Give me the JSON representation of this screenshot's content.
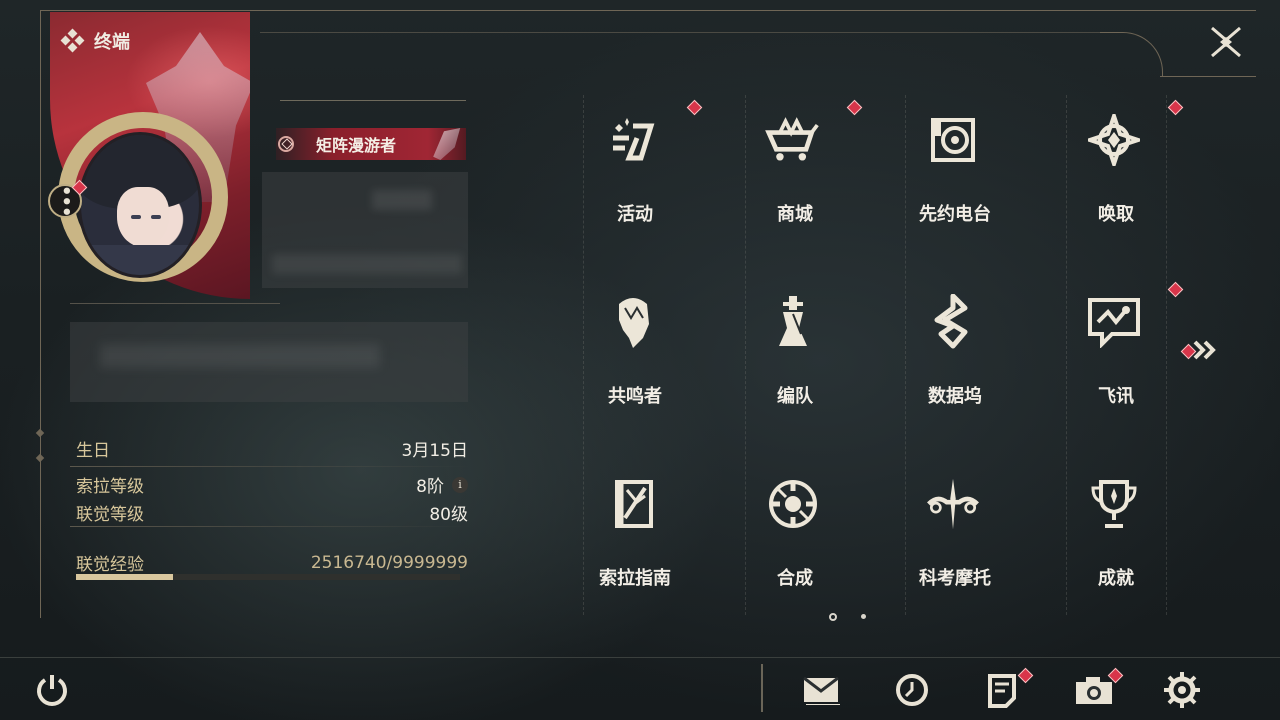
{
  "header": {
    "title": "终端"
  },
  "profile": {
    "title_badge": "矩阵漫游者"
  },
  "info": {
    "birthday_label": "生日",
    "birthday_value": "3月15日",
    "sola_level_label": "索拉等级",
    "sola_level_value": "8阶",
    "union_level_label": "联觉等级",
    "union_level_value": "80级",
    "union_exp_label": "联觉经验",
    "union_exp_value": "2516740/9999999",
    "union_exp_progress": 0.2517
  },
  "menu": {
    "items": [
      {
        "label": "活动",
        "icon": "activity-icon",
        "badge": true
      },
      {
        "label": "商城",
        "icon": "shop-basket-icon",
        "badge": true
      },
      {
        "label": "先约电台",
        "icon": "radio-icon",
        "badge": false
      },
      {
        "label": "唤取",
        "icon": "convene-icon",
        "badge": true
      },
      {
        "label": "共鸣者",
        "icon": "resonator-icon",
        "badge": false
      },
      {
        "label": "编队",
        "icon": "team-chess-icon",
        "badge": false
      },
      {
        "label": "数据坞",
        "icon": "data-dock-icon",
        "badge": false
      },
      {
        "label": "飞讯",
        "icon": "message-chat-icon",
        "badge": true
      },
      {
        "label": "索拉指南",
        "icon": "guide-book-icon",
        "badge": false
      },
      {
        "label": "合成",
        "icon": "synthesis-icon",
        "badge": false
      },
      {
        "label": "科考摩托",
        "icon": "motorcycle-icon",
        "badge": false
      },
      {
        "label": "成就",
        "icon": "trophy-icon",
        "badge": false
      }
    ],
    "page_indicator": {
      "current": 1,
      "total": 2
    }
  },
  "bottom_bar": {
    "icons": [
      "power-icon",
      "mail-icon",
      "clock-icon",
      "notice-icon",
      "camera-icon",
      "settings-gear-icon"
    ]
  },
  "colors": {
    "accent_gold": "#d8c79b",
    "badge_red": "#d8354a",
    "background": "#1c2224"
  }
}
